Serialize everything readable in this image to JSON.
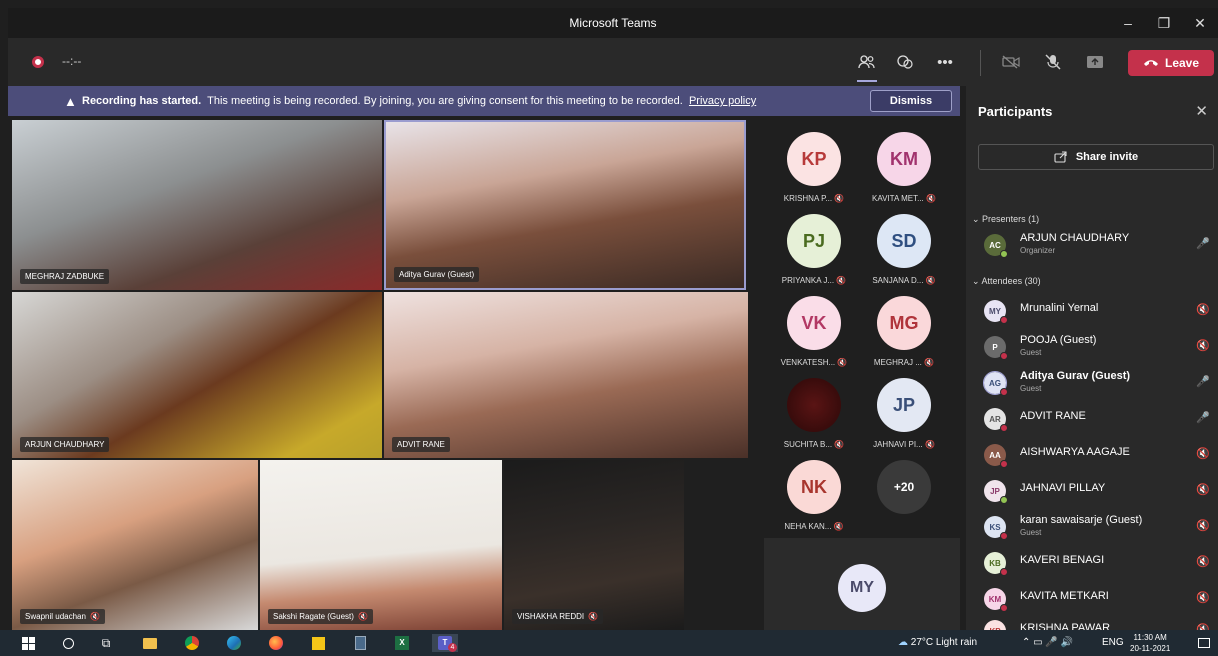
{
  "window": {
    "title": "Microsoft Teams",
    "minimize": "–",
    "maximize": "❐",
    "close": "✕"
  },
  "meeting": {
    "timer": "--:--",
    "leave_label": "Leave"
  },
  "banner": {
    "bold": "Recording has started.",
    "text": "This meeting is being recorded. By joining, you are giving consent for this meeting to be recorded.",
    "link": "Privacy policy",
    "dismiss": "Dismiss"
  },
  "tiles": [
    {
      "name": "MEGHRAJ ZADBUKE",
      "muted": false
    },
    {
      "name": "Aditya Gurav (Guest)",
      "muted": false
    },
    {
      "name": "ARJUN CHAUDHARY",
      "muted": false
    },
    {
      "name": "ADVIT RANE",
      "muted": false
    },
    {
      "name": "Swapnil udachan",
      "muted": true
    },
    {
      "name": "Sakshi Ragate (Guest)",
      "muted": true
    },
    {
      "name": "VISHAKHA REDDI",
      "muted": true
    }
  ],
  "avatars": [
    {
      "initials": "KP",
      "caption": "KRISHNA P...",
      "bg": "#fbe3e3",
      "fg": "#b73a3a"
    },
    {
      "initials": "KM",
      "caption": "KAVITA MET...",
      "bg": "#f7d6e8",
      "fg": "#a1326d"
    },
    {
      "initials": "PJ",
      "caption": "PRIYANKA J...",
      "bg": "#e6f0d7",
      "fg": "#4a6b1f"
    },
    {
      "initials": "SD",
      "caption": "SANJANA D...",
      "bg": "#dde7f5",
      "fg": "#2f4f80"
    },
    {
      "initials": "VK",
      "caption": "VENKATESH...",
      "bg": "#fadde8",
      "fg": "#b23864"
    },
    {
      "initials": "MG",
      "caption": "MEGHRAJ ...",
      "bg": "#fad8da",
      "fg": "#b0343b"
    },
    {
      "initials": "",
      "caption": "SUCHITA B...",
      "bg": "#4a1010",
      "fg": "#ffffff"
    },
    {
      "initials": "JP",
      "caption": "JAHNAVI PI...",
      "bg": "#e3e8f3",
      "fg": "#3a4f78"
    },
    {
      "initials": "NK",
      "caption": "NEHA KAN...",
      "bg": "#fad9d6",
      "fg": "#a8352d"
    },
    {
      "initials": "+20",
      "caption": "",
      "bg": "#3a3a3a",
      "fg": "#ffffff"
    }
  ],
  "self_tile": {
    "initials": "MY"
  },
  "panel": {
    "title": "Participants",
    "share": "Share invite",
    "presenters_header": "Presenters (1)",
    "attendees_header": "Attendees (30)",
    "presenters": [
      {
        "initials": "AC",
        "name": "ARJUN CHAUDHARY",
        "sub": "Organizer",
        "mic": "🎤",
        "bg": "#5a6b3a",
        "status": "#92c353"
      }
    ],
    "attendees": [
      {
        "initials": "MY",
        "name": "Mrunalini Yernal",
        "sub": "",
        "mic": "🔇",
        "bg": "#e8e4f4",
        "status": "#c4314b"
      },
      {
        "initials": "P",
        "name": "POOJA (Guest)",
        "sub": "Guest",
        "mic": "🔇",
        "bg": "#6b6b6b",
        "status": "#c4314b"
      },
      {
        "initials": "AG",
        "name": "Aditya Gurav (Guest)",
        "sub": "Guest",
        "mic": "🎤",
        "bg": "#dfe3f4",
        "status": "#c4314b"
      },
      {
        "initials": "AR",
        "name": "ADVIT RANE",
        "sub": "",
        "mic": "🎤",
        "bg": "#e4e4e4",
        "status": "#c4314b"
      },
      {
        "initials": "AA",
        "name": "AISHWARYA AAGAJE",
        "sub": "",
        "mic": "🔇",
        "bg": "#8a5a4a",
        "status": "#c4314b"
      },
      {
        "initials": "JP",
        "name": "JAHNAVI PILLAY",
        "sub": "",
        "mic": "🔇",
        "bg": "#f0e4ec",
        "status": "#92c353"
      },
      {
        "initials": "KS",
        "name": "karan sawaisarje (Guest)",
        "sub": "Guest",
        "mic": "🔇",
        "bg": "#dde4f2",
        "status": "#c4314b"
      },
      {
        "initials": "KB",
        "name": "KAVERI BENAGI",
        "sub": "",
        "mic": "🔇",
        "bg": "#e6f0d7",
        "status": "#c4314b"
      },
      {
        "initials": "KM",
        "name": "KAVITA METKARI",
        "sub": "",
        "mic": "🔇",
        "bg": "#f7d6e8",
        "status": "#c4314b"
      },
      {
        "initials": "KP",
        "name": "KRISHNA PAWAR",
        "sub": "",
        "mic": "🔇",
        "bg": "#fbe3e3",
        "status": "#c4314b"
      }
    ]
  },
  "taskbar": {
    "weather": "27°C  Light rain",
    "lang": "ENG",
    "time": "11:30 AM",
    "date": "20-11-2021",
    "teams_badge": "4"
  }
}
